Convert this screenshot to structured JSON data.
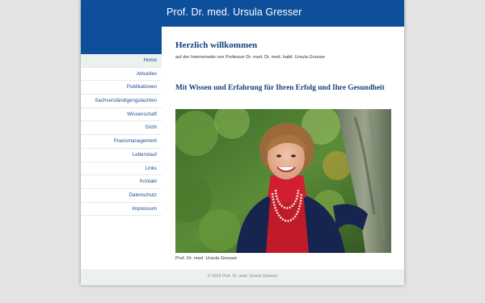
{
  "header": {
    "title": "Prof. Dr. med. Ursula Gresser"
  },
  "nav": {
    "items": [
      {
        "label": "Home",
        "active": true
      },
      {
        "label": "Aktuelles"
      },
      {
        "label": "Publikationen"
      },
      {
        "label": "Sachverständigengutachten"
      },
      {
        "label": "Wissenschaft"
      },
      {
        "label": "Gicht"
      },
      {
        "label": "Praxismanagement"
      },
      {
        "label": "Lebenslauf"
      },
      {
        "label": "Links"
      },
      {
        "label": "Kontakt"
      },
      {
        "label": "Datenschutz"
      },
      {
        "label": "Impressum"
      }
    ]
  },
  "main": {
    "welcome_title": "Herzlich willkommen",
    "welcome_subtitle": "auf der Internetseite von Professor Dr. med. Dr. med. habil. Ursula Gresser",
    "tagline": "Mit Wissen und Erfahrung für Ihren Erfolg und Ihre Gesundheit",
    "photo_caption": "Prof. Dr. med. Ursula Gresser"
  },
  "footer": {
    "text": "© 2015 Prof. Dr. med. Ursula Gresser"
  },
  "colors": {
    "brand_blue": "#0e4f9b",
    "heading_blue": "#123f7a",
    "nav_link": "#1f4f93",
    "nav_active_bg": "#eaf1ee",
    "page_bg": "#e3e3e3"
  }
}
